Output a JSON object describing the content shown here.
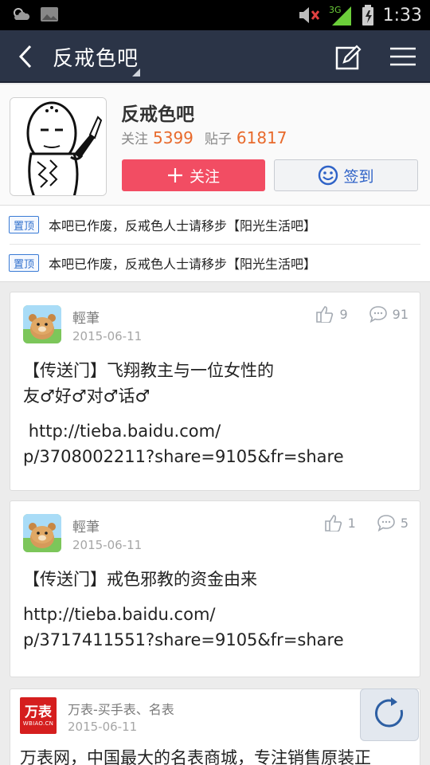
{
  "status_bar": {
    "time": "1:33",
    "network": "3G",
    "icons": [
      "weather-icon",
      "image-icon",
      "mute-icon",
      "signal-icon",
      "battery-icon"
    ]
  },
  "navbar": {
    "title": "反戒色吧",
    "icons": [
      "back-icon",
      "edit-icon",
      "menu-icon"
    ]
  },
  "forum": {
    "name": "反戒色吧",
    "follow_label": "关注",
    "follow_count": "5399",
    "posts_label": "贴子",
    "posts_count": "61817",
    "follow_button": "关注",
    "sign_button": "签到"
  },
  "pinned": [
    {
      "badge": "置顶",
      "text": "本吧已作废，反戒色人士请移步【阳光生活吧】"
    },
    {
      "badge": "置顶",
      "text": "本吧已作废，反戒色人士请移步【阳光生活吧】"
    }
  ],
  "posts": [
    {
      "user": "輕茟",
      "date": "2015-06-11",
      "likes": "9",
      "comments": "91",
      "body": [
        "【传送门】飞翔教主与一位女性的",
        "友♂好♂对♂话♂",
        "http://tieba.baidu.com/",
        "p/3708002211?share=9105&fr=share"
      ]
    },
    {
      "user": "輕茟",
      "date": "2015-06-11",
      "likes": "1",
      "comments": "5",
      "body": [
        "【传送门】戒色邪教的资金由来",
        "http://tieba.baidu.com/",
        "p/3717411551?share=9105&fr=share"
      ]
    }
  ],
  "ad": {
    "logo_text": "万表",
    "logo_sub": "WBIAO.CN",
    "user": "万表-买手表、名表",
    "date": "2015-06-11",
    "body": "万表网，中国最大的名表商城，专注销售原装正"
  },
  "colors": {
    "navbar_bg": "#2b3447",
    "follow_btn": "#f24d63",
    "count_orange": "#e86a2c",
    "sign_blue": "#2e62c7"
  }
}
